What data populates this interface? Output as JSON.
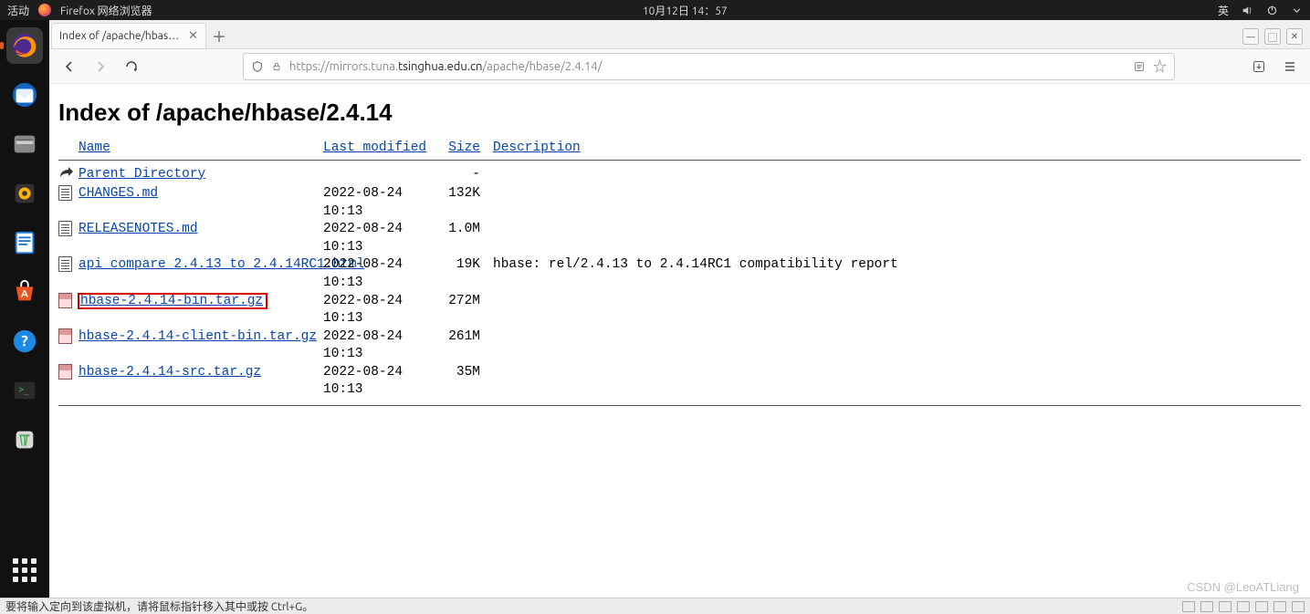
{
  "gnome": {
    "activities": "活动",
    "app_label": "Firefox 网络浏览器",
    "clock": "10月12日  14：57",
    "input_method": "英"
  },
  "tab": {
    "title": "Index of /apache/hbase/2.4…"
  },
  "url": {
    "scheme": "https://",
    "dim_pre": "mirrors.tuna.",
    "host": "tsinghua.edu.cn",
    "path": "/apache/hbase/2.4.14/"
  },
  "page": {
    "heading": "Index of /apache/hbase/2.4.14",
    "columns": {
      "name": "Name",
      "modified": "Last modified",
      "size": "Size",
      "desc": "Description"
    },
    "parent": "Parent Directory",
    "parent_size": "-",
    "rows": [
      {
        "icon": "txt",
        "name": "CHANGES.md",
        "modified": "2022-08-24 10:13",
        "size": "132K",
        "desc": "",
        "highlight": false
      },
      {
        "icon": "txt",
        "name": "RELEASENOTES.md",
        "modified": "2022-08-24 10:13",
        "size": "1.0M",
        "desc": "",
        "highlight": false
      },
      {
        "icon": "txt",
        "name": "api_compare_2.4.13_to_2.4.14RC1.html",
        "modified": "2022-08-24 10:13",
        "size": "19K",
        "desc": "hbase: rel/2.4.13 to 2.4.14RC1 compatibility report",
        "highlight": false
      },
      {
        "icon": "gz",
        "name": "hbase-2.4.14-bin.tar.gz",
        "modified": "2022-08-24 10:13",
        "size": "272M",
        "desc": "",
        "highlight": true
      },
      {
        "icon": "gz",
        "name": "hbase-2.4.14-client-bin.tar.gz",
        "modified": "2022-08-24 10:13",
        "size": "261M",
        "desc": "",
        "highlight": false
      },
      {
        "icon": "gz",
        "name": "hbase-2.4.14-src.tar.gz",
        "modified": "2022-08-24 10:13",
        "size": "35M",
        "desc": "",
        "highlight": false
      }
    ]
  },
  "watermark": "CSDN @LeoATLiang",
  "vmware": {
    "hint": "要将输入定向到该虚拟机，请将鼠标指针移入其中或按 Ctrl+G。"
  }
}
